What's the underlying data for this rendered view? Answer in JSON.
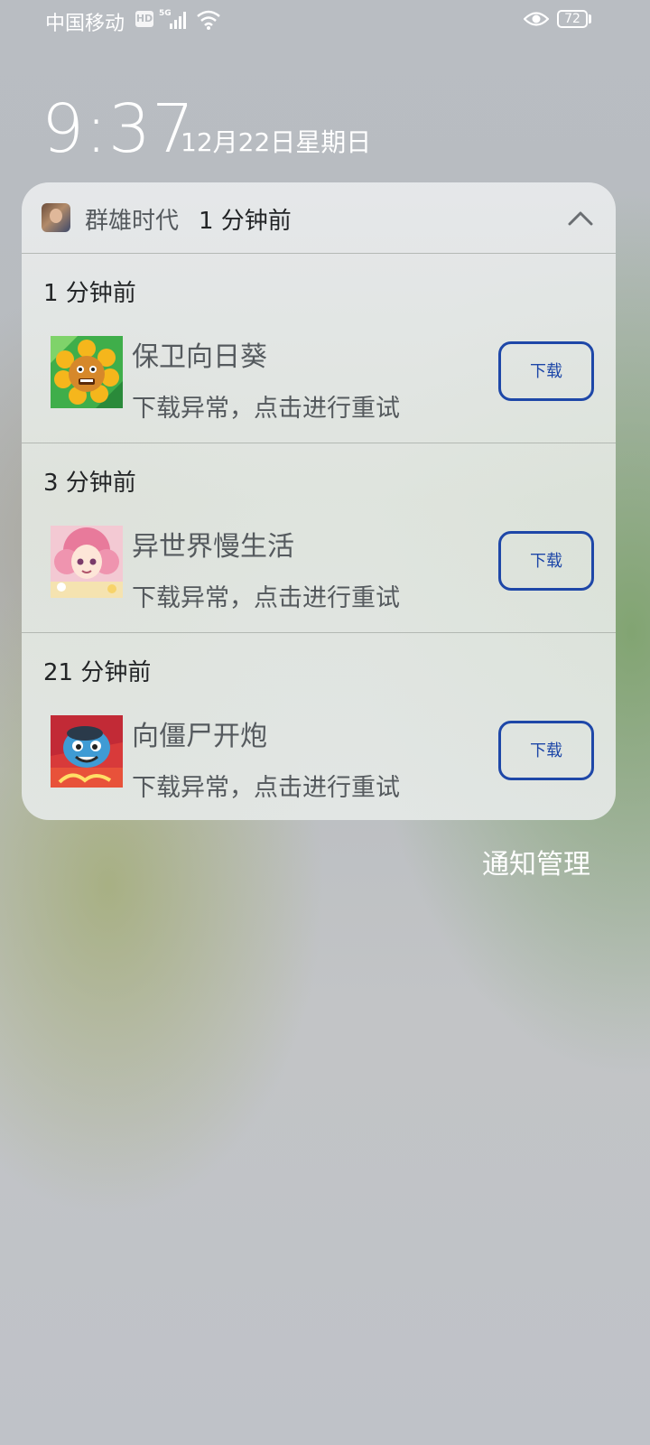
{
  "status_bar": {
    "carrier": "中国移动",
    "hd": "HD",
    "network": "5G",
    "battery": "72"
  },
  "lockscreen": {
    "time": "9:37",
    "date": "12月22日星期日"
  },
  "notification_group": {
    "app_name": "群雄时代",
    "time": "1 分钟前",
    "items": [
      {
        "time": "1 分钟前",
        "title": "保卫向日葵",
        "message": "下载异常，点击进行重试",
        "button": "下载"
      },
      {
        "time": "3 分钟前",
        "title": "异世界慢生活",
        "message": "下载异常，点击进行重试",
        "button": "下载"
      },
      {
        "time": "21 分钟前",
        "title": "向僵尸开炮",
        "message": "下载异常，点击进行重试",
        "button": "下载"
      }
    ]
  },
  "footer": {
    "manage_label": "通知管理"
  },
  "colors": {
    "accent": "#1e47a8",
    "text_primary": "#222426",
    "text_secondary": "#555a5e"
  }
}
